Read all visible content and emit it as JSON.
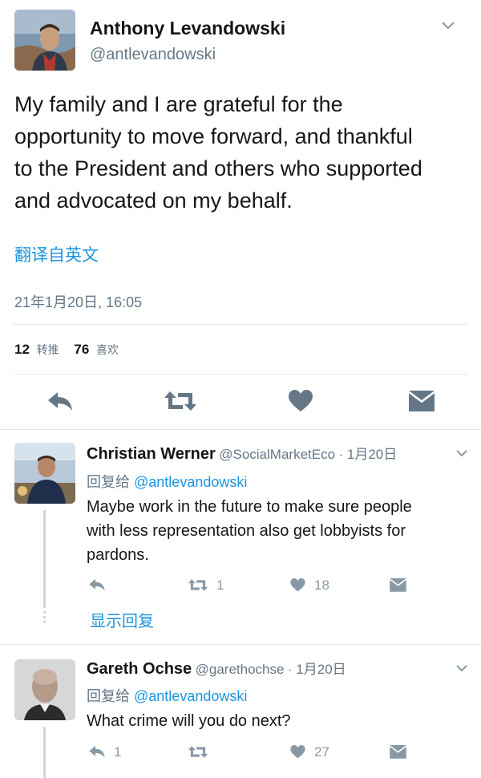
{
  "main_tweet": {
    "name": "Anthony Levandowski",
    "handle": "@antlevandowski",
    "text": "My family and I are grateful for the opportunity to move forward, and thankful to the President and others who supported and advocated on my behalf.",
    "text_lines": [
      "My family and I are grateful for the",
      "opportunity to move forward, and thankful",
      "to the President and others who supported",
      "and advocated on my behalf."
    ],
    "translate": "翻译自英文",
    "timestamp": "21年1月20日, 16:05",
    "retweet_count": "12",
    "retweet_label": "转推",
    "like_count": "76",
    "like_label": "喜欢"
  },
  "replies": [
    {
      "name": "Christian Werner",
      "handle": "@SocialMarketEco",
      "date": "· 1月20日",
      "reply_to_label": "回复给",
      "reply_to": "@antlevandowski",
      "text_lines": [
        "Maybe work in the future to make sure people",
        "with less representation also get lobbyists for",
        "pardons."
      ],
      "reply_count": "",
      "retweet_count": "1",
      "like_count": "18",
      "show_replies": "显示回复"
    },
    {
      "name": "Gareth Ochse",
      "handle": "@garethochse",
      "date": "· 1月20日",
      "reply_to_label": "回复给",
      "reply_to": "@antlevandowski",
      "text_lines": [
        "What crime will you do next?"
      ],
      "reply_count": "1",
      "retweet_count": "",
      "like_count": "27"
    }
  ],
  "colors": {
    "link": "#1b95e0",
    "muted": "#657786",
    "icon": "#8899a6",
    "main_icon": "#657786",
    "divider": "#e1e8ed"
  }
}
